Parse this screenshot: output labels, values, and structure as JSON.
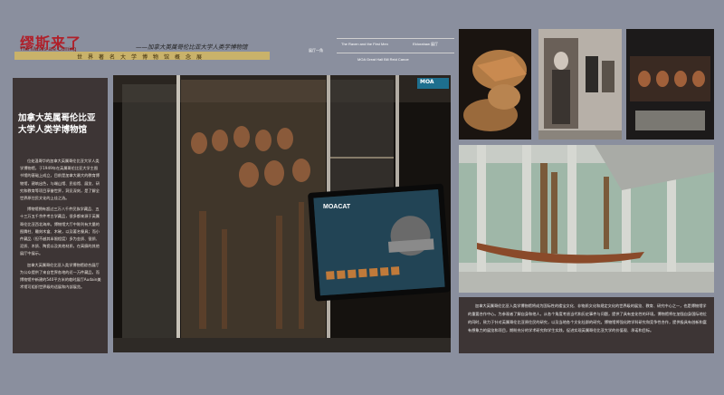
{
  "header": {
    "logo_main": "缪斯来了",
    "logo_sub": "The Muses are Coming",
    "subtitle": "——加拿大英属哥伦比亚大学人类学博物馆",
    "series_title": "世界著名大学博物馆概念展"
  },
  "exhibit_labels": {
    "small_label": "展厅一角",
    "label_1": "The Raven and the First Men",
    "label_2": "Eldorahaw 展厅",
    "label_3": "MOA Great Hall Bill Reid Canoe"
  },
  "left_panel": {
    "title": "加拿大英属哥伦比亚大学人类学博物馆",
    "paragraphs": [
      "位处温哥华的加拿大英属哥伦比亚大学人类学博物馆，于1949年在英属哥伦比亚大学主图书馆的基础上成立，目前是加拿大最大的教育博物馆，建筑出色，与端山馆、民俗馆、展览、研究和教育等项目享誉世界，洞见深刻，是了解全世界原住民文化的上佳之选。",
      "博物馆拥有超过三万八千件民族学藏品、五十三万五千余件考古学藏品，很多都来源于英属哥伦比亚西北海岸。博物馆大厅中陈列有大量的图腾柱、雕刻木盒、木碗，以及著名餐具；而小件藏品（但不越其半限程度）多为金质、银质、泥质、木质、陶瓷以及其他材质，在高廊的其他展厅中展示。",
      "加拿大英属哥伦比亚人类学博物馆综合展厅为公众提供了来自世界各地的近一万件藏品，而博物馆中新建的540平方米的临时展厅Audain美术馆可组织世界级的适展和内部展览。"
    ]
  },
  "photo_overlay": {
    "moa_badge": "MOA",
    "moacat_title": "MOACAT"
  },
  "bottom_panel": {
    "text": "加拿大英属哥伦比亚人类学博物馆将成为国际性的楼宝文化、非物质文化和规定文化的世界级的展览、教育、研究中心之一，也是博物馆学的重要合作中心。为参观者了解自身和他人，从各个角度考虑当代和历史事件与问题，提供了具有变化性的环境。博物馆将在加强自身国际地位的同时，致力于针对英属哥伦比亚原住民的研究，以及当地各个文化社群的研究。博物馆将强化跨学科研究和竞争性合作，提供极具有创新和富有想象力的展览和项目，期盼充分的学术研究和学生实践，促进实现英属哥伦比亚大学的价值观、承诺和目标。"
  },
  "colors": {
    "background": "#8a8f9e",
    "panel": "#3d3535",
    "gold": "#c9b26a",
    "logo_red": "#b0202a"
  }
}
